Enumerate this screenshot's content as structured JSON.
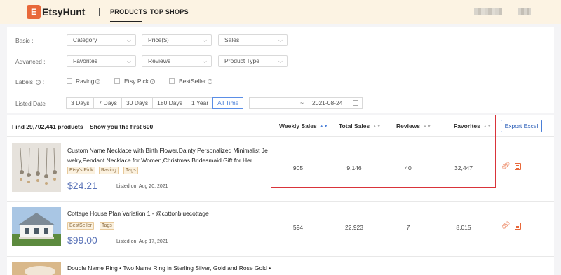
{
  "header": {
    "logo_letter": "E",
    "logo_text": "EtsyHunt",
    "nav": [
      {
        "label": "PRODUCTS",
        "active": true
      },
      {
        "label": "TOP SHOPS",
        "active": false
      }
    ]
  },
  "filters": {
    "basic_label": "Basic :",
    "basic": [
      "Category",
      "Price($)",
      "Sales"
    ],
    "advanced_label": "Advanced :",
    "advanced": [
      "Favorites",
      "Reviews",
      "Product Type"
    ],
    "labels_label": "Labels",
    "labels": [
      "Raving",
      "Etsy Pick",
      "BestSeller"
    ],
    "listed_label": "Listed Date :",
    "date_buttons": [
      "3 Days",
      "7 Days",
      "30 Days",
      "180 Days",
      "1 Year",
      "All Time"
    ],
    "active_date": "All Time",
    "date_range": {
      "separator": "~",
      "end": "2021-08-24"
    }
  },
  "results": {
    "found_text": "Find 29,702,441 products",
    "first_text": "Show you the first 600",
    "columns": [
      "Weekly Sales",
      "Total Sales",
      "Reviews",
      "Favorites"
    ],
    "sorted_column": "Weekly Sales",
    "export_label": "Export Excel"
  },
  "products": [
    {
      "title": "Custom Name Necklace with Birth Flower,Dainty Personalized Minimalist Je welry,Pendant Necklace for Women,Christmas Bridesmaid Gift for Her",
      "tags": [
        "Etsy's Pick",
        "Raving",
        "Tags"
      ],
      "price": "$24.21",
      "listed": "Listed on: Aug 20, 2021",
      "weekly_sales": "905",
      "total_sales": "9,146",
      "reviews": "40",
      "favorites": "32,447"
    },
    {
      "title": "Cottage House Plan Variation 1 - @cottonbluecottage",
      "tags": [
        "BestSeller",
        "Tags"
      ],
      "price": "$99.00",
      "listed": "Listed on: Aug 17, 2021",
      "weekly_sales": "594",
      "total_sales": "22,923",
      "reviews": "7",
      "favorites": "8,015"
    },
    {
      "title": "Double Name Ring • Two Name Ring in Sterling Silver, Gold and Rose Gold •"
    }
  ],
  "colors": {
    "accent": "#e8683a",
    "link_blue": "#4a7fd8",
    "highlight": "#d9343a",
    "header_bg": "#fcf3e3"
  },
  "icons": [
    "link-icon",
    "report-icon",
    "calendar-icon",
    "help-icon",
    "sort-icon"
  ]
}
